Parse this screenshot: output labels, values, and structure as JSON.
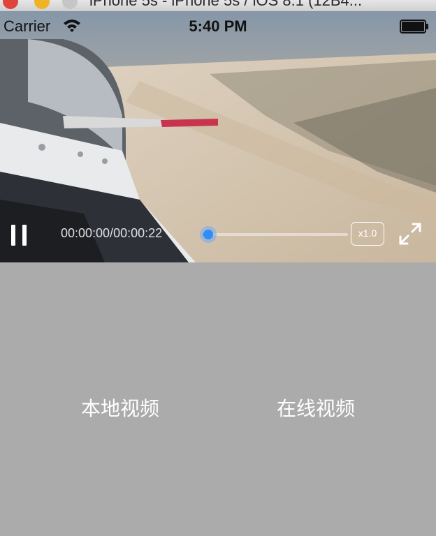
{
  "window": {
    "title": "iPhone 5s - iPhone 5s / iOS 8.1 (12B4..."
  },
  "status_bar": {
    "carrier": "Carrier",
    "time": "5:40 PM"
  },
  "player": {
    "time_display": "00:00:00/00:00:22",
    "progress_fraction": 0.02,
    "rate_label": "x1.0",
    "state": "playing"
  },
  "menu": {
    "local_video": "本地视频",
    "online_video": "在线视频"
  },
  "colors": {
    "accent": "#2f8ef5",
    "background": "#ababab"
  }
}
